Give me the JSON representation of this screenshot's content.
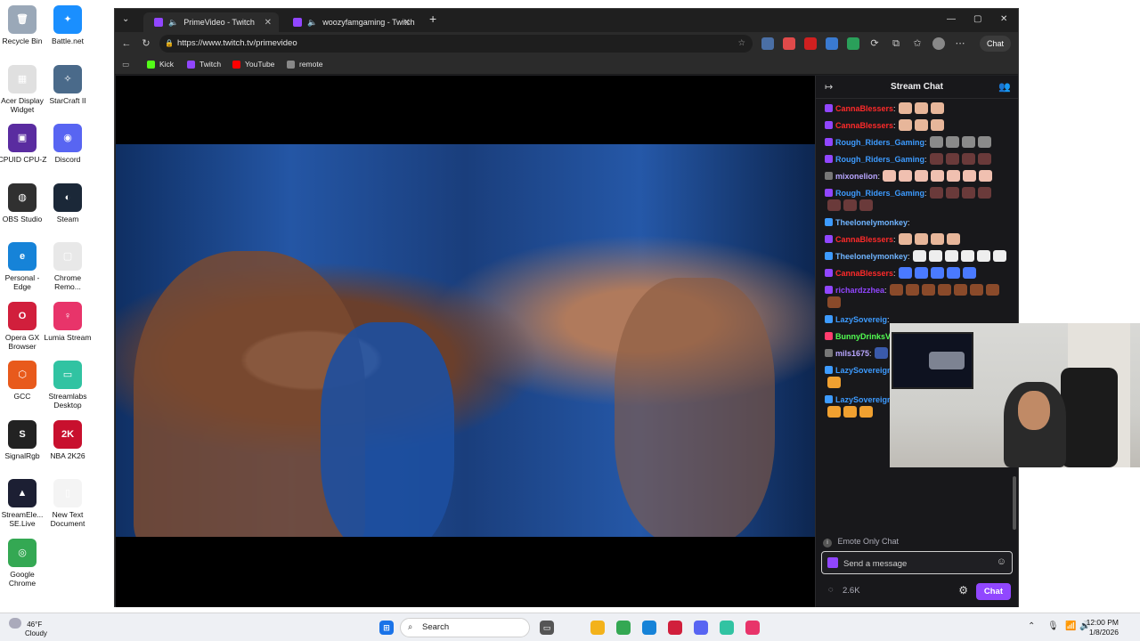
{
  "desktop": {
    "icons": [
      {
        "label": "Recycle Bin",
        "color": "#9aa8b8",
        "glyph": "🗑"
      },
      {
        "label": "Battle.net",
        "color": "#1a8fff",
        "glyph": "✦"
      },
      {
        "label": "Acer Display Widget",
        "color": "#e0e0e0",
        "glyph": "▦"
      },
      {
        "label": "StarCraft II",
        "color": "#4a6a8a",
        "glyph": "✧"
      },
      {
        "label": "CPUID CPU-Z",
        "color": "#5a2ca0",
        "glyph": "▣"
      },
      {
        "label": "Discord",
        "color": "#5865f2",
        "glyph": "◉"
      },
      {
        "label": "OBS Studio",
        "color": "#303030",
        "glyph": "◍"
      },
      {
        "label": "Steam",
        "color": "#1b2838",
        "glyph": "◐"
      },
      {
        "label": "Personal - Edge",
        "color": "#1683d8",
        "glyph": "e"
      },
      {
        "label": "Chrome Remo...",
        "color": "#e8e8e8",
        "glyph": "▢"
      },
      {
        "label": "Opera GX Browser",
        "color": "#d11f3c",
        "glyph": "O"
      },
      {
        "label": "Lumia Stream",
        "color": "#e8346a",
        "glyph": "♀"
      },
      {
        "label": "GCC",
        "color": "#e85a1c",
        "glyph": "⬡"
      },
      {
        "label": "Streamlabs Desktop",
        "color": "#31c3a2",
        "glyph": "▭"
      },
      {
        "label": "SignalRgb",
        "color": "#222222",
        "glyph": "S"
      },
      {
        "label": "NBA 2K26",
        "color": "#c8102e",
        "glyph": "2K"
      },
      {
        "label": "StreamEle... SE.Live",
        "color": "#1c1f33",
        "glyph": "▲"
      },
      {
        "label": "New Text Document",
        "color": "#f4f4f4",
        "glyph": "▯"
      },
      {
        "label": "Google Chrome",
        "color": "#34a853",
        "glyph": "◎"
      }
    ]
  },
  "browser": {
    "tabs": [
      {
        "title": "PrimeVideo - Twitch",
        "active": true
      },
      {
        "title": "woozyfamgaming - Twitch",
        "active": false
      }
    ],
    "new_tab": "+",
    "url": "https://www.twitch.tv/primevideo",
    "copilot_label": "Chat",
    "bookmarks": [
      {
        "label": "Kick",
        "color": "#53fc18"
      },
      {
        "label": "Twitch",
        "color": "#9146ff"
      },
      {
        "label": "YouTube",
        "color": "#ff0000"
      },
      {
        "label": "remote",
        "color": "#888888"
      }
    ]
  },
  "chat": {
    "title": "Stream Chat",
    "messages": [
      {
        "user": "CannaBlessers",
        "color": "#ff2a2a",
        "emotes": 3,
        "emote_color": "#e7b69a",
        "badge": "#9146ff"
      },
      {
        "user": "CannaBlessers",
        "color": "#ff2a2a",
        "emotes": 3,
        "emote_color": "#e7b69a",
        "badge": "#9146ff"
      },
      {
        "user": "Rough_Riders_Gaming",
        "color": "#3d9bff",
        "emotes": 4,
        "emote_color": "#8a8a8a",
        "badge": "#9146ff"
      },
      {
        "user": "Rough_Riders_Gaming",
        "color": "#3d9bff",
        "emotes": 4,
        "emote_color": "#6a3a3a",
        "badge": "#9146ff"
      },
      {
        "user": "mixonelion",
        "color": "#b9a6ff",
        "emotes": 7,
        "emote_color": "#f0c0b0",
        "badge": "#777777"
      },
      {
        "user": "Rough_Riders_Gaming",
        "color": "#3d9bff",
        "emotes": 7,
        "emote_color": "#6a3a3a",
        "badge": "#9146ff"
      },
      {
        "user": "Theelonelymonkey",
        "color": "#6fb4ff",
        "emotes": 0,
        "emote_color": "#ffffff",
        "badge": "#3d9bff"
      },
      {
        "user": "CannaBlessers",
        "color": "#ff2a2a",
        "emotes": 4,
        "emote_color": "#e7b69a",
        "badge": "#9146ff"
      },
      {
        "user": "Theelonelymonkey",
        "color": "#6fb4ff",
        "emotes": 6,
        "emote_color": "#eeeeee",
        "badge": "#3d9bff"
      },
      {
        "user": "CannaBlessers",
        "color": "#ff2a2a",
        "emotes": 5,
        "emote_color": "#4a7aff",
        "badge": "#9146ff"
      },
      {
        "user": "richardzzhea",
        "color": "#9146ff",
        "emotes": 8,
        "emote_color": "#8a4a2a",
        "badge": "#9146ff"
      },
      {
        "user": "LazySovereig",
        "color": "#3d9bff",
        "emotes": 0,
        "emote_color": "#ffcc44",
        "badge": "#3d9bff"
      },
      {
        "user": "BunnyDrinksV",
        "color": "#52ff52",
        "emotes": 4,
        "emote_color": "#dddddd",
        "badge": "#ff3d6e"
      },
      {
        "user": "mils1675",
        "color": "#b9a6ff",
        "emotes": 1,
        "emote_color": "#3a5aaa",
        "badge": "#777777"
      },
      {
        "user": "LazySovereignOfGaming",
        "color": "#3d9bff",
        "emotes": 5,
        "emote_color": "#f0a030",
        "badge": "#3d9bff"
      },
      {
        "user": "LazySovereignOfGaming",
        "color": "#3d9bff",
        "emotes": 7,
        "emote_color": "#f0a030",
        "badge": "#3d9bff"
      }
    ],
    "mode_notice": "Emote Only Chat",
    "input_placeholder": "Send a message",
    "viewer_count": "2.6K",
    "send_label": "Chat"
  },
  "taskbar": {
    "weather_temp": "46°F",
    "weather_desc": "Cloudy",
    "search_label": "Search",
    "time": "12:00 PM",
    "date": "1/8/2026",
    "apps": [
      {
        "name": "file-explorer",
        "color": "#f3b21b"
      },
      {
        "name": "chrome",
        "color": "#34a853"
      },
      {
        "name": "edge",
        "color": "#1683d8"
      },
      {
        "name": "opera-gx",
        "color": "#d11f3c"
      },
      {
        "name": "discord",
        "color": "#5865f2"
      },
      {
        "name": "streamlabs",
        "color": "#31c3a2"
      },
      {
        "name": "lumia",
        "color": "#e8346a"
      }
    ]
  }
}
